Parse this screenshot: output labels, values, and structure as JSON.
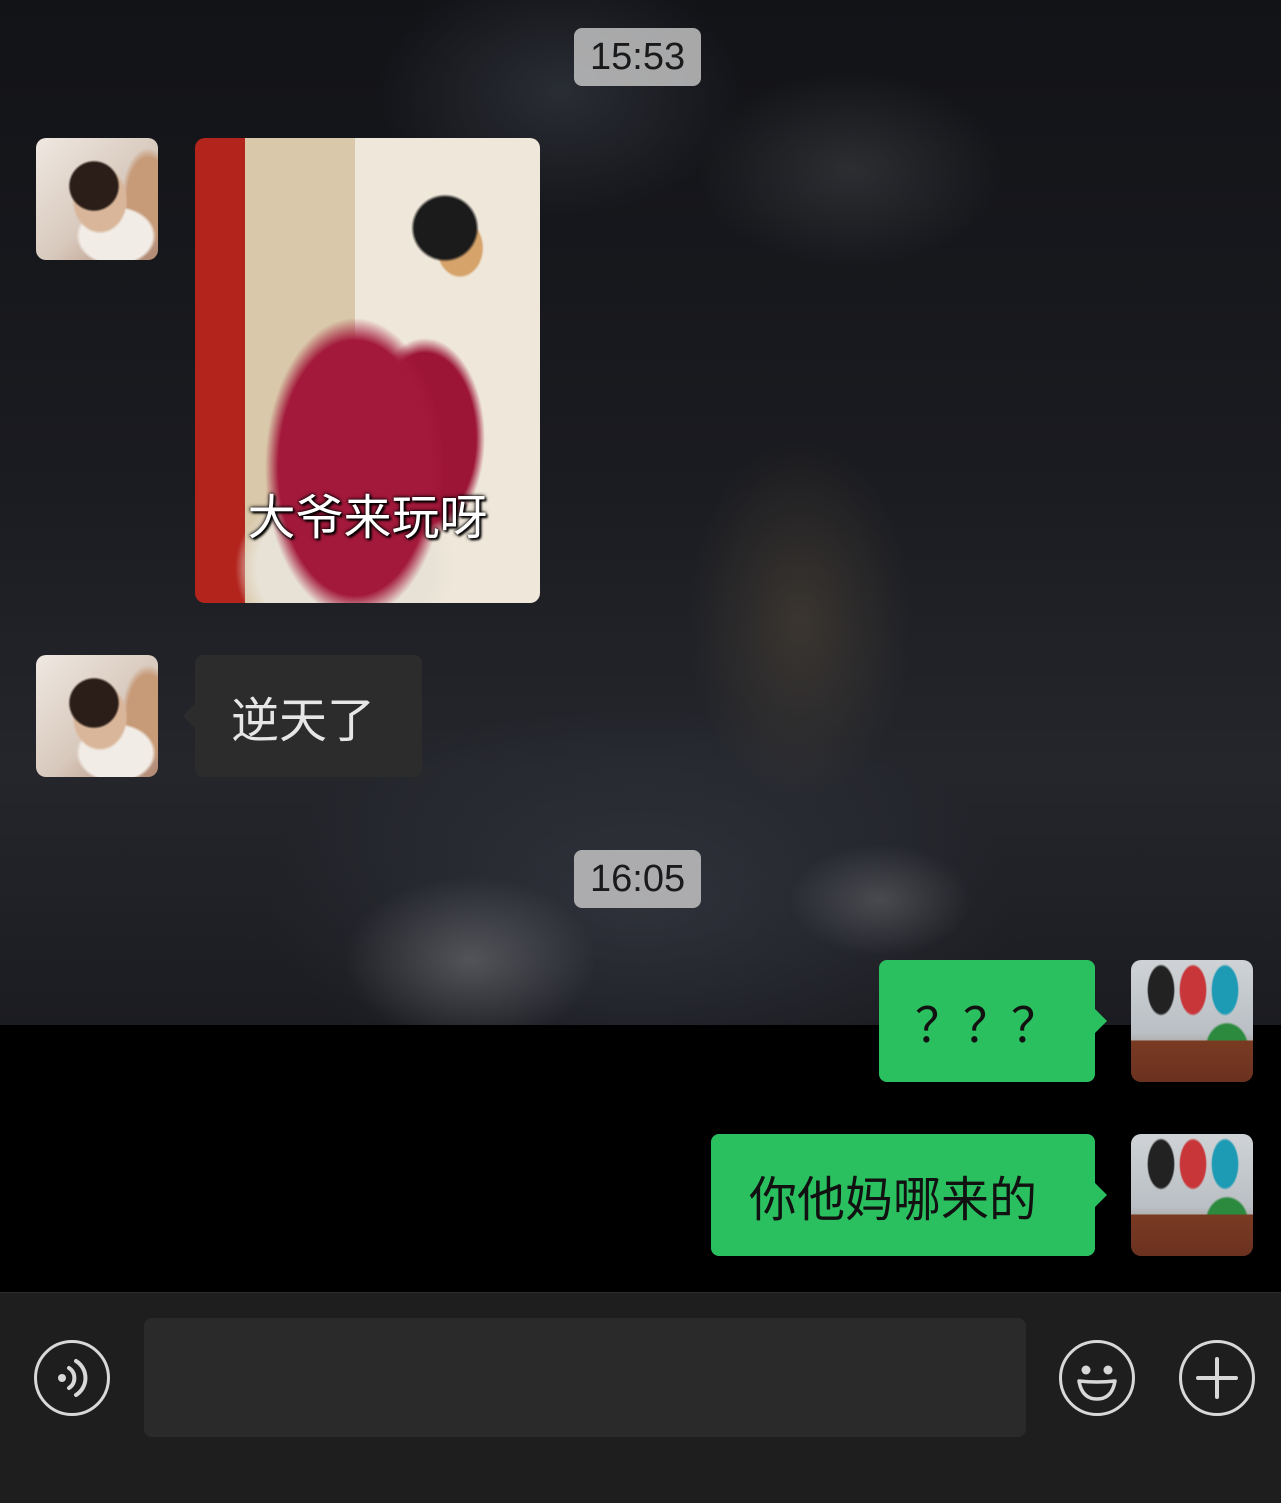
{
  "chat": {
    "messages": [
      {
        "type": "time",
        "text": "15:53"
      },
      {
        "type": "image",
        "sender": "friend",
        "caption": "大爷来玩呀"
      },
      {
        "type": "text",
        "sender": "friend",
        "text": "逆天了"
      },
      {
        "type": "time",
        "text": "16:05"
      },
      {
        "type": "text",
        "sender": "me",
        "text": "？？？"
      },
      {
        "type": "text",
        "sender": "me",
        "text": "你他妈哪来的"
      }
    ]
  },
  "input_bar": {
    "voice_icon": "voice-icon",
    "emoji_icon": "emoji-icon",
    "more_icon": "plus-icon",
    "text_value": ""
  },
  "colors": {
    "outgoing_bubble": "#2bc05f",
    "incoming_bubble": "#2c2c2c",
    "time_pill": "#c8c8c8",
    "input_bar": "#1e1e1e"
  }
}
